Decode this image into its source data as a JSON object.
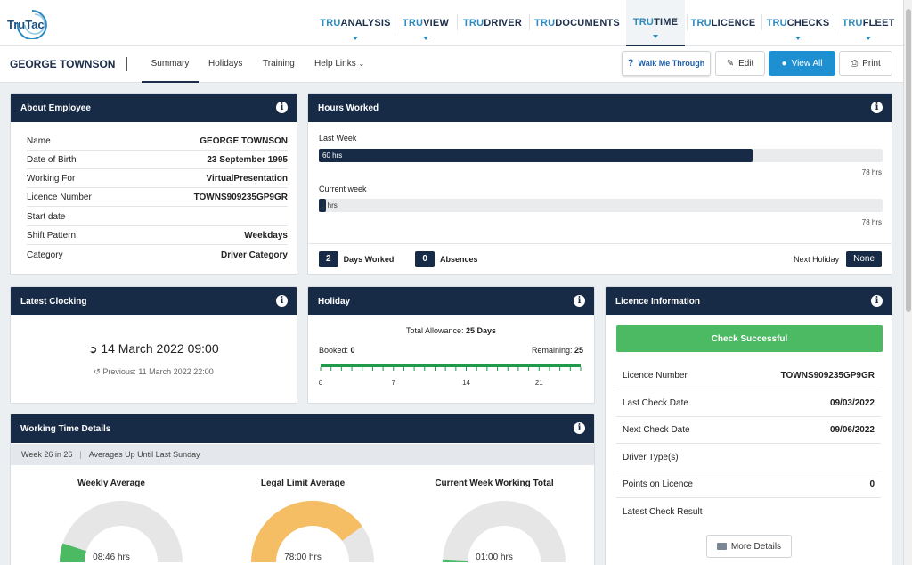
{
  "logo": {
    "text": "TruTac"
  },
  "modules": [
    {
      "prefix": "TRU",
      "name": "ANALYSIS"
    },
    {
      "prefix": "TRU",
      "name": "VIEW"
    },
    {
      "prefix": "TRU",
      "name": "DRIVER"
    },
    {
      "prefix": "TRU",
      "name": "DOCUMENTS"
    },
    {
      "prefix": "TRU",
      "name": "TIME"
    },
    {
      "prefix": "TRU",
      "name": "LICENCE"
    },
    {
      "prefix": "TRU",
      "name": "CHECKS"
    },
    {
      "prefix": "TRU",
      "name": "FLEET"
    }
  ],
  "header": {
    "employee_name": "GEORGE TOWNSON",
    "tabs": [
      "Summary",
      "Holidays",
      "Training",
      "Help Links"
    ],
    "walk_me": "Walk Me Through",
    "edit": "Edit",
    "view_all": "View All",
    "print": "Print"
  },
  "about": {
    "title": "About Employee",
    "rows": [
      {
        "label": "Name",
        "value": "GEORGE TOWNSON"
      },
      {
        "label": "Date of Birth",
        "value": "23 September 1995"
      },
      {
        "label": "Working For",
        "value": "VirtualPresentation"
      },
      {
        "label": "Licence Number",
        "value": "TOWNS909235GP9GR"
      },
      {
        "label": "Start date",
        "value": ""
      },
      {
        "label": "Shift Pattern",
        "value": "Weekdays"
      },
      {
        "label": "Category",
        "value": "Driver Category"
      }
    ]
  },
  "hours": {
    "title": "Hours Worked",
    "last_week_label": "Last Week",
    "last_week_value": "60 hrs",
    "last_week_fraction": 0.769,
    "max_label": "78 hrs",
    "current_week_label": "Current week",
    "current_week_value": "1 hrs",
    "current_week_fraction": 0.013,
    "days_worked": "2",
    "days_worked_label": "Days Worked",
    "absences": "0",
    "absences_label": "Absences",
    "next_holiday_label": "Next Holiday",
    "next_holiday_value": "None"
  },
  "clocking": {
    "title": "Latest Clocking",
    "latest": "14 March 2022 09:00",
    "previous": "Previous: 11 March 2022 22:00"
  },
  "holiday": {
    "title": "Holiday",
    "allowance_label": "Total Allowance:",
    "allowance_value": "25 Days",
    "booked_label": "Booked:",
    "booked_value": "0",
    "remaining_label": "Remaining:",
    "remaining_value": "25",
    "ticks": [
      "0",
      "7",
      "14",
      "21"
    ],
    "scale_max": 25
  },
  "licence": {
    "title": "Licence Information",
    "status": "Check Successful",
    "rows": [
      {
        "label": "Licence Number",
        "value": "TOWNS909235GP9GR"
      },
      {
        "label": "Last Check Date",
        "value": "09/03/2022"
      },
      {
        "label": "Next Check Date",
        "value": "09/06/2022"
      },
      {
        "label": "Driver Type(s)",
        "value": ""
      },
      {
        "label": "Points on Licence",
        "value": "0"
      },
      {
        "label": "Latest Check Result",
        "value": ""
      }
    ],
    "more_details": "More Details"
  },
  "working_time": {
    "title": "Working Time Details",
    "week_info": "Week 26 in 26",
    "averages_info": "Averages Up Until Last Sunday",
    "gauges": [
      {
        "title": "Weekly Average",
        "value": "08:46 hrs",
        "fraction": 0.1,
        "color": "#4cb963"
      },
      {
        "title": "Legal Limit Average",
        "value": "78:00 hrs",
        "fraction": 0.8,
        "color": "#f5bd64"
      },
      {
        "title": "Current Week Working Total",
        "value": "01:00 hrs",
        "fraction": 0.015,
        "color": "#4cb963"
      }
    ]
  },
  "colors": {
    "navy": "#172b47",
    "accent": "#2e8bc0",
    "green": "#4cb963",
    "orange": "#f5bd64"
  }
}
